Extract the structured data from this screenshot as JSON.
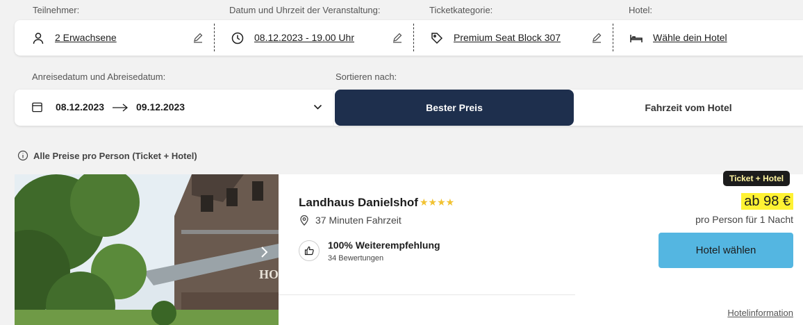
{
  "filters": {
    "participants_label": "Teilnehmer:",
    "participants_value": "2 Erwachsene",
    "event_label": "Datum und Uhrzeit der Veranstaltung:",
    "event_value": "08.12.2023 - 19.00 Uhr",
    "ticket_label": "Ticketkategorie:",
    "ticket_value": "Premium Seat Block 307",
    "hotel_label": "Hotel:",
    "hotel_value": "Wähle dein Hotel"
  },
  "dates": {
    "label": "Anreisedatum und Abreisedatum:",
    "arrival": "08.12.2023",
    "departure": "09.12.2023"
  },
  "sort": {
    "label": "Sortieren nach:",
    "best_price": "Bester Preis",
    "travel_time": "Fahrzeit vom Hotel",
    "active": "best_price"
  },
  "info_note": "Alle Preise pro Person (Ticket + Hotel)",
  "hotel": {
    "name": "Landhaus Danielshof",
    "stars": "★★★★",
    "travel_time": "37 Minuten Fahrzeit",
    "recommendation": "100% Weiterempfehlung",
    "reviews": "34 Bewertungen",
    "badge": "Ticket + Hotel",
    "price": "ab 98 €",
    "price_note": "pro Person für 1 Nacht",
    "select_button": "Hotel wählen",
    "info_link": "Hotelinformation"
  },
  "colors": {
    "accent_dark": "#1e2f4d",
    "button_blue": "#54b6e1",
    "highlight_yellow": "#fff233",
    "star_gold": "#f1c232"
  }
}
